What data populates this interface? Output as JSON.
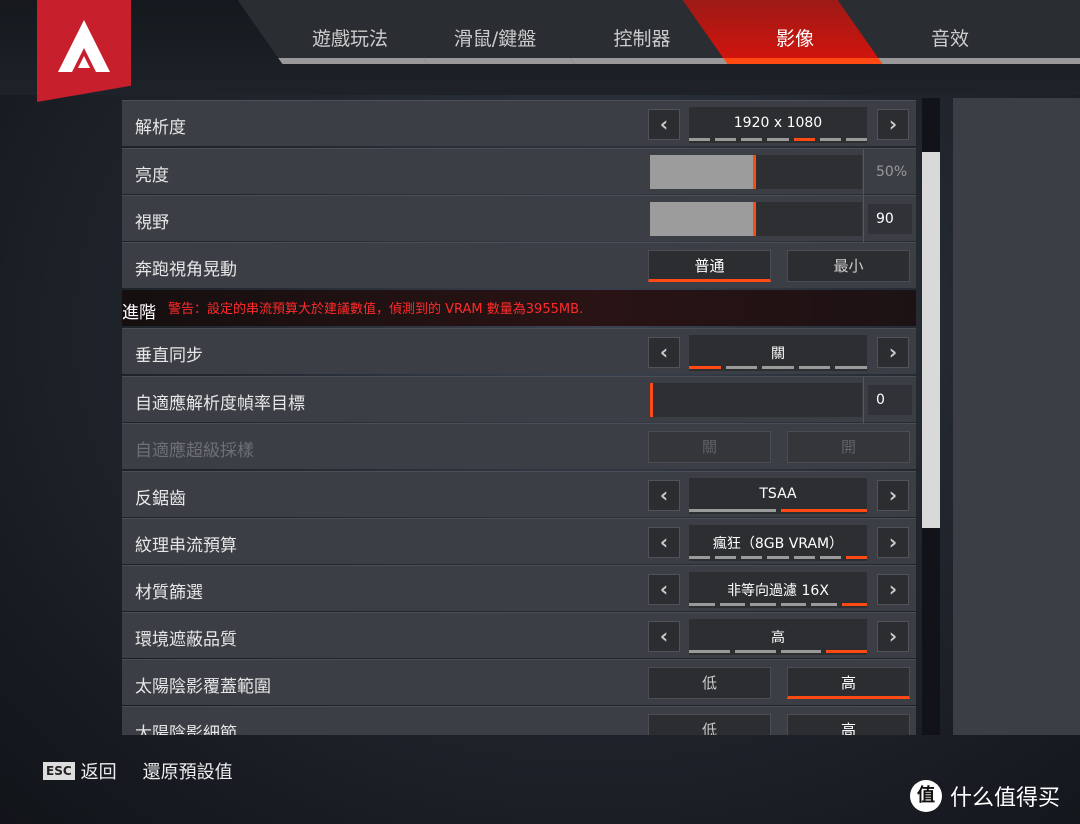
{
  "tabs": [
    {
      "label": "遊戲玩法",
      "active": false
    },
    {
      "label": "滑鼠/鍵盤",
      "active": false
    },
    {
      "label": "控制器",
      "active": false
    },
    {
      "label": "影像",
      "active": true
    },
    {
      "label": "音效",
      "active": false
    }
  ],
  "settings": {
    "resolution": {
      "label": "解析度",
      "value": "1920 x 1080",
      "segments": 7,
      "selected": 4
    },
    "brightness": {
      "label": "亮度",
      "percent": 50,
      "value": "50%"
    },
    "fov": {
      "label": "視野",
      "value": "90",
      "fill_percent": 50
    },
    "sprint_bob": {
      "label": "奔跑視角晃動",
      "options": [
        "普通",
        "最小"
      ],
      "selected": 0
    },
    "advanced": {
      "label": "進階",
      "warning": "警告：設定的串流預算大於建議數值，偵測到的 VRAM 數量為3955MB."
    },
    "vsync": {
      "label": "垂直同步",
      "value": "關",
      "segments": 5,
      "selected": 0
    },
    "adaptive_res": {
      "label": "自適應解析度幀率目標",
      "value": "0",
      "fill_percent": 0
    },
    "adaptive_ss": {
      "label": "自適應超級採樣",
      "options": [
        "關",
        "開"
      ],
      "selected": 0,
      "disabled": true
    },
    "aa": {
      "label": "反鋸齒",
      "value": "TSAA",
      "segments": 2,
      "selected": 1
    },
    "texture": {
      "label": "紋理串流預算",
      "value": "瘋狂（8GB VRAM）",
      "segments": 7,
      "selected": 6
    },
    "filter": {
      "label": "材質篩選",
      "value": "非等向過濾 16X",
      "segments": 6,
      "selected": 5
    },
    "ao": {
      "label": "環境遮蔽品質",
      "value": "高",
      "segments": 4,
      "selected": 3
    },
    "sun_coverage": {
      "label": "太陽陰影覆蓋範圍",
      "options": [
        "低",
        "高"
      ],
      "selected": 1
    },
    "sun_detail": {
      "label": "太陽陰影細節",
      "options": [
        "低",
        "高"
      ],
      "selected": 1
    }
  },
  "footer": {
    "esc_key": "ESC",
    "back": "返回",
    "reset": "還原預設值"
  },
  "watermark": {
    "icon": "值",
    "text": "什么值得买"
  },
  "colors": {
    "accent": "#ff4a14",
    "logo_red": "#c71f2c",
    "warning": "#ff2a2a"
  }
}
